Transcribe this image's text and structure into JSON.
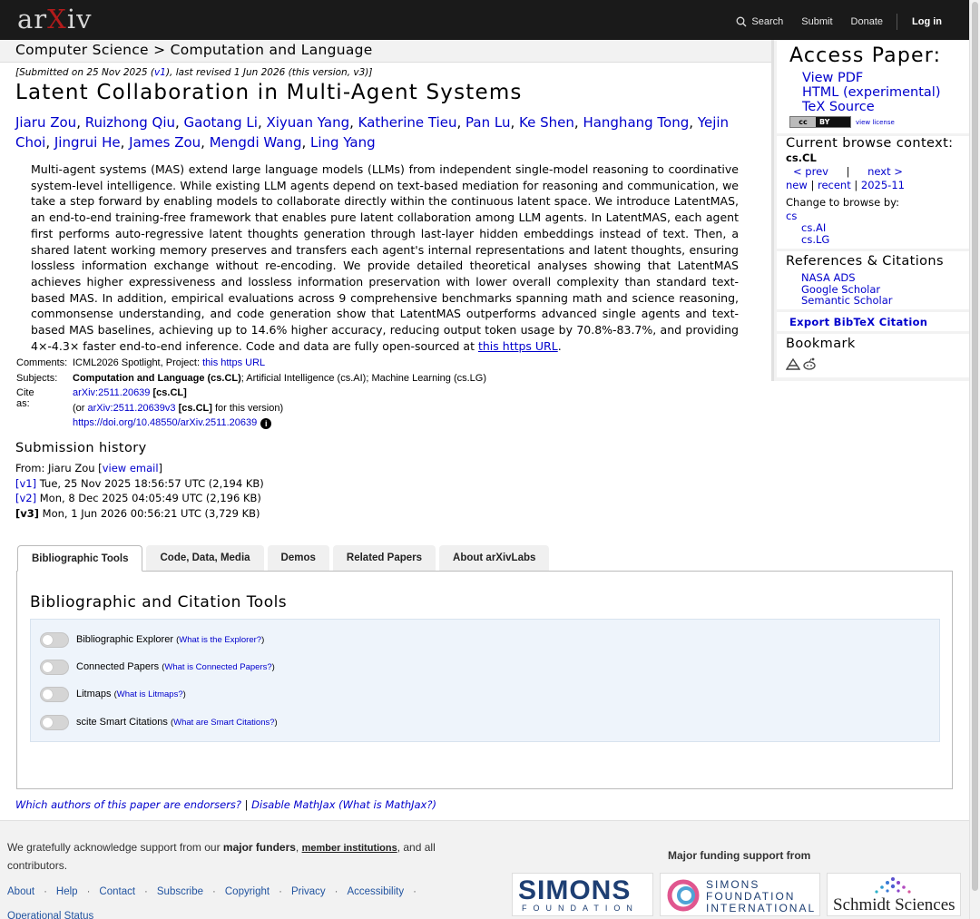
{
  "topbar": {
    "logo": "arXiv",
    "search": "Search",
    "submit": "Submit",
    "donate": "Donate",
    "login": "Log in"
  },
  "breadcrumb": "Computer Science > Computation and Language",
  "dateline": {
    "prefix": "[Submitted on 25 Nov 2025 (",
    "v1": "v1",
    "suffix": "), last revised 1 Jun 2026 (this version, v3)]"
  },
  "paper": {
    "title": "Latent Collaboration in Multi-Agent Systems",
    "authors": [
      "Jiaru Zou",
      "Ruizhong Qiu",
      "Gaotang Li",
      "Xiyuan Yang",
      "Katherine Tieu",
      "Pan Lu",
      "Ke Shen",
      "Hanghang Tong",
      "Yejin Choi",
      "Jingrui He",
      "James Zou",
      "Mengdi Wang",
      "Ling Yang"
    ],
    "abstract": "Multi-agent systems (MAS) extend large language models (LLMs) from independent single-model reasoning to coordinative system-level intelligence. While existing LLM agents depend on text-based mediation for reasoning and communication, we take a step forward by enabling models to collaborate directly within the continuous latent space. We introduce LatentMAS, an end-to-end training-free framework that enables pure latent collaboration among LLM agents. In LatentMAS, each agent first performs auto-regressive latent thoughts generation through last-layer hidden embeddings instead of text. Then, a shared latent working memory preserves and transfers each agent's internal representations and latent thoughts, ensuring lossless information exchange without re-encoding. We provide detailed theoretical analyses showing that LatentMAS achieves higher expressiveness and lossless information preservation with lower overall complexity than standard text-based MAS. In addition, empirical evaluations across 9 comprehensive benchmarks spanning math and science reasoning, commonsense understanding, and code generation show that LatentMAS outperforms advanced single agents and text-based MAS baselines, achieving up to 14.6% higher accuracy, reducing output token usage by 70.8%-83.7%, and providing 4×-4.3× faster end-to-end inference. Code and data are fully open-sourced at",
    "abstract_link": "this https URL",
    "abstract_end": "."
  },
  "meta": {
    "comments_label": "Comments:",
    "comments_text": "ICML2026 Spotlight, Project: ",
    "comments_link": "this https URL",
    "subjects_label": "Subjects:",
    "subjects_primary": "Computation and Language (cs.CL)",
    "subjects_rest": "; Artificial Intelligence (cs.AI); Machine Learning (cs.LG)",
    "cite_label": "Cite as:",
    "cite_id": "arXiv:2511.20639",
    "cite_tag": "[cs.CL]",
    "cite2_pre": "(or ",
    "cite2_id": "arXiv:2511.20639v3",
    "cite2_tag": "[cs.CL]",
    "cite2_post": " for this version)",
    "doi": "https://doi.org/10.48550/arXiv.2511.20639",
    "doi_icon": "i"
  },
  "submission": {
    "heading": "Submission history",
    "from_prefix": "From: Jiaru Zou [",
    "from_link": "view email",
    "from_suffix": "]",
    "versions": [
      {
        "label": "[v1]",
        "text": " Tue, 25 Nov 2025 18:56:57 UTC (2,194 KB)"
      },
      {
        "label": "[v2]",
        "text": " Mon, 8 Dec 2025 04:05:49 UTC (2,196 KB)"
      },
      {
        "label": "[v3]",
        "text": " Mon, 1 Jun 2026 00:56:21 UTC (3,729 KB)"
      }
    ]
  },
  "tabs": [
    "Bibliographic Tools",
    "Code, Data, Media",
    "Demos",
    "Related Papers",
    "About arXivLabs"
  ],
  "tools": {
    "title": "Bibliographic and Citation Tools",
    "items": [
      {
        "name": "Bibliographic Explorer",
        "help": "What is the Explorer?"
      },
      {
        "name": "Connected Papers",
        "help": "What is Connected Papers?"
      },
      {
        "name": "Litmaps",
        "help": "What is Litmaps?"
      },
      {
        "name": "scite Smart Citations",
        "help": "What are Smart Citations?"
      }
    ]
  },
  "endorse": {
    "q1": "Which authors of this paper are endorsers?",
    "sep": " | ",
    "q2": "Disable MathJax",
    "q3": " (What is MathJax?)"
  },
  "footer": {
    "ack_pre": "We gratefully acknowledge support from our ",
    "ack_funders": "major funders",
    "ack_mid": ", ",
    "ack_members": "member institutions",
    "ack_post": ", and all contributors.",
    "links": [
      "About",
      "Help",
      "Contact",
      "Subscribe",
      "Copyright",
      "Privacy",
      "Accessibility"
    ],
    "opstatus": "Operational Status",
    "funding_heading": "Major funding support from",
    "simons_word": "SIMONS",
    "simons_sub": "FOUNDATION",
    "sfi_1": "SIMONS",
    "sfi_2": "FOUNDATION",
    "sfi_3": "INTERNATIONAL",
    "schmidt": "Schmidt Sciences"
  },
  "sidebar": {
    "access_heading": "Access Paper:",
    "access_links": [
      "View PDF",
      "HTML (experimental)",
      "TeX Source"
    ],
    "cc_left": "cc",
    "cc_right": "BY",
    "view_license": "view license",
    "browse_heading": "Current browse context:",
    "browse_context": "cs.CL",
    "prev": "< prev",
    "pipe": "|",
    "next": "next >",
    "new": "new",
    "recent": "recent",
    "month": "2025-11",
    "change_browse": "Change to browse by:",
    "browse_by": [
      "cs",
      "cs.AI",
      "cs.LG"
    ],
    "refs_heading": "References & Citations",
    "refs": [
      "NASA ADS",
      "Google Scholar",
      "Semantic Scholar"
    ],
    "export": "Export BibTeX Citation",
    "bookmark_heading": "Bookmark"
  },
  "colors": {
    "link": "#0000cc",
    "topbar": "#1a1a1a",
    "arxiv_red": "#b31b1b"
  }
}
